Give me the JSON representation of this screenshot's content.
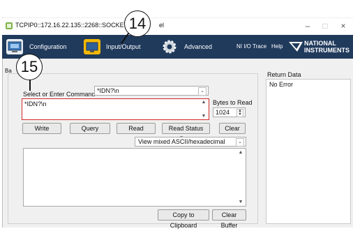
{
  "window": {
    "title": "TCPIP0::172.16.22.135::2268::SOCKET",
    "title_tail": "el"
  },
  "ribbon": {
    "configuration": "Configuration",
    "input_output": "Input/Output",
    "advanced": "Advanced",
    "ni_io_trace": "NI I/O Trace",
    "help": "Help",
    "brand_top": "NATIONAL",
    "brand_bottom": "INSTRUMENTS"
  },
  "panel": {
    "tab_fragment": "Ba",
    "command_label": "Select or Enter Command",
    "command_value": "*IDN?\\n",
    "command_text": "*IDN?\\n",
    "bytes_label": "Bytes to Read",
    "bytes_value": "1024",
    "buttons": {
      "write": "Write",
      "query": "Query",
      "read": "Read",
      "read_status_byte": "Read Status Byte",
      "clear": "Clear"
    },
    "view_mode": "View mixed ASCII/hexadecimal",
    "copy_clipboard": "Copy to Clipboard",
    "clear_buffer": "Clear Buffer"
  },
  "return_data": {
    "label": "Return Data",
    "value": "No Error"
  },
  "callouts": {
    "c14": "14",
    "c15": "15"
  },
  "colors": {
    "ribbon": "#203a5c",
    "highlight_border": "#d22a2a",
    "selected_tab_icon": "#f5b800"
  }
}
